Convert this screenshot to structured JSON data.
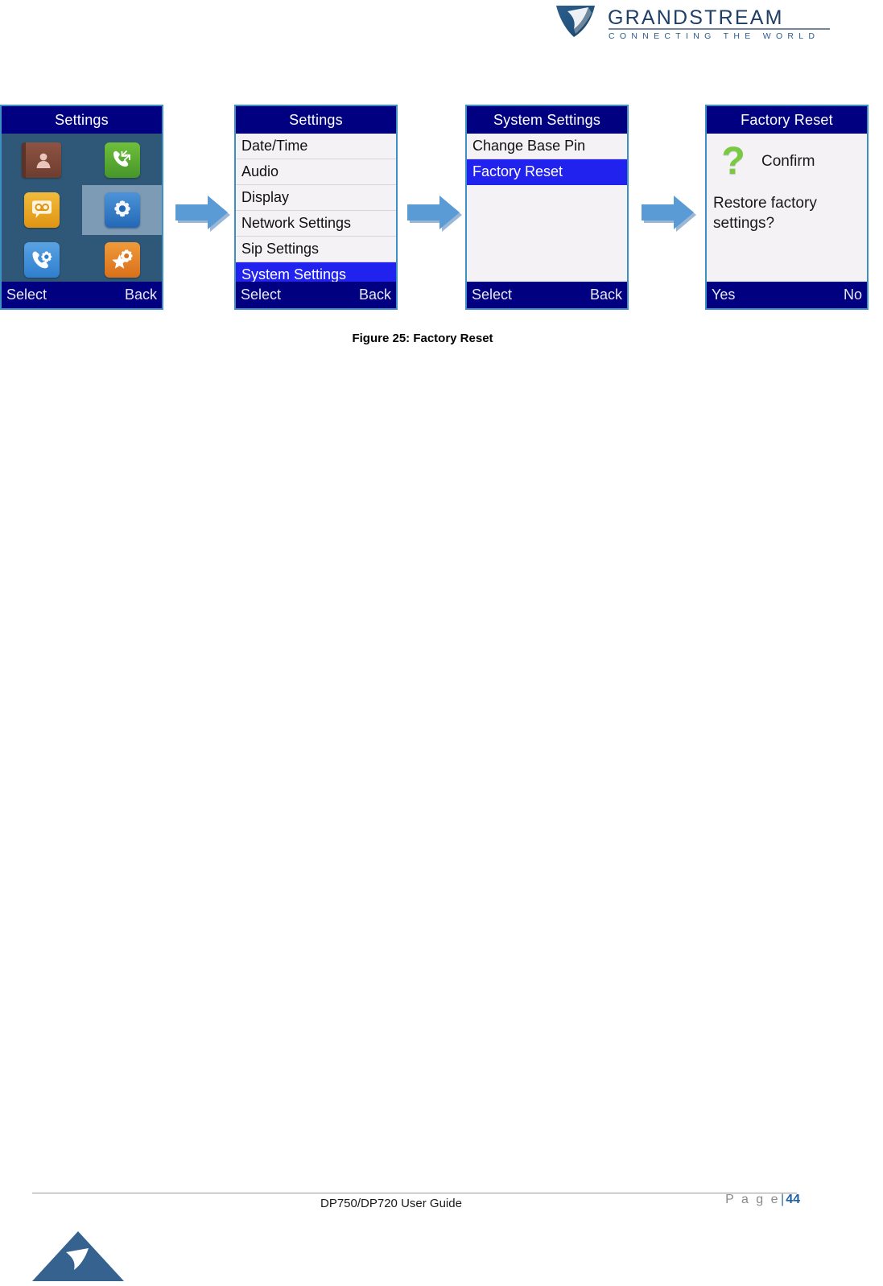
{
  "document": {
    "brand": "GRANDSTREAM",
    "brand_tagline": "CONNECTING THE WORLD",
    "figure_caption": "Figure 25: Factory Reset",
    "footer_doc_title": "DP750/DP720 User Guide",
    "footer_page_word": "P a g e",
    "footer_page_separator": "|",
    "footer_page_number": "44"
  },
  "colors": {
    "header_blue": "#000080",
    "highlight_blue": "#2222ee",
    "grid_background": "#2f5878",
    "grid_highlight": "#7e9bb5",
    "screen_border": "#3e8fc4",
    "list_background": "#f5f2f5",
    "arrow_blue": "#5b9bd5",
    "brand_blue": "#2e5c8a",
    "question_green": "#7ac943"
  },
  "screens": [
    {
      "id": "settings-icon-grid",
      "title": "Settings",
      "type": "icon-grid",
      "softkey_left": "Select",
      "softkey_right": "Back",
      "tiles": [
        {
          "name": "contacts",
          "icon": "contacts-icon",
          "selected": false
        },
        {
          "name": "call-history",
          "icon": "call-history-icon",
          "selected": false
        },
        {
          "name": "voicemail",
          "icon": "voicemail-icon",
          "selected": false
        },
        {
          "name": "settings",
          "icon": "settings-gear-icon",
          "selected": true
        },
        {
          "name": "call-settings",
          "icon": "call-settings-icon",
          "selected": false
        },
        {
          "name": "shortcut",
          "icon": "shortcut-star-icon",
          "selected": false
        }
      ]
    },
    {
      "id": "settings-list",
      "title": "Settings",
      "type": "list",
      "softkey_left": "Select",
      "softkey_right": "Back",
      "items": [
        {
          "label": "Date/Time",
          "selected": false
        },
        {
          "label": "Audio",
          "selected": false
        },
        {
          "label": "Display",
          "selected": false
        },
        {
          "label": "Network Settings",
          "selected": false
        },
        {
          "label": "Sip Settings",
          "selected": false
        },
        {
          "label": "System Settings",
          "selected": true
        }
      ]
    },
    {
      "id": "system-settings-list",
      "title": "System Settings",
      "type": "list",
      "softkey_left": "Select",
      "softkey_right": "Back",
      "items": [
        {
          "label": "Change Base Pin",
          "selected": false
        },
        {
          "label": "Factory Reset",
          "selected": true
        }
      ]
    },
    {
      "id": "factory-reset-confirm",
      "title": "Factory Reset",
      "type": "confirm",
      "icon": "question-mark-icon",
      "confirm_label": "Confirm",
      "question": "Restore factory settings?",
      "softkey_left": "Yes",
      "softkey_right": "No"
    }
  ],
  "arrows": [
    {
      "name": "arrow-1",
      "direction": "right"
    },
    {
      "name": "arrow-2",
      "direction": "right"
    },
    {
      "name": "arrow-3",
      "direction": "right"
    }
  ]
}
